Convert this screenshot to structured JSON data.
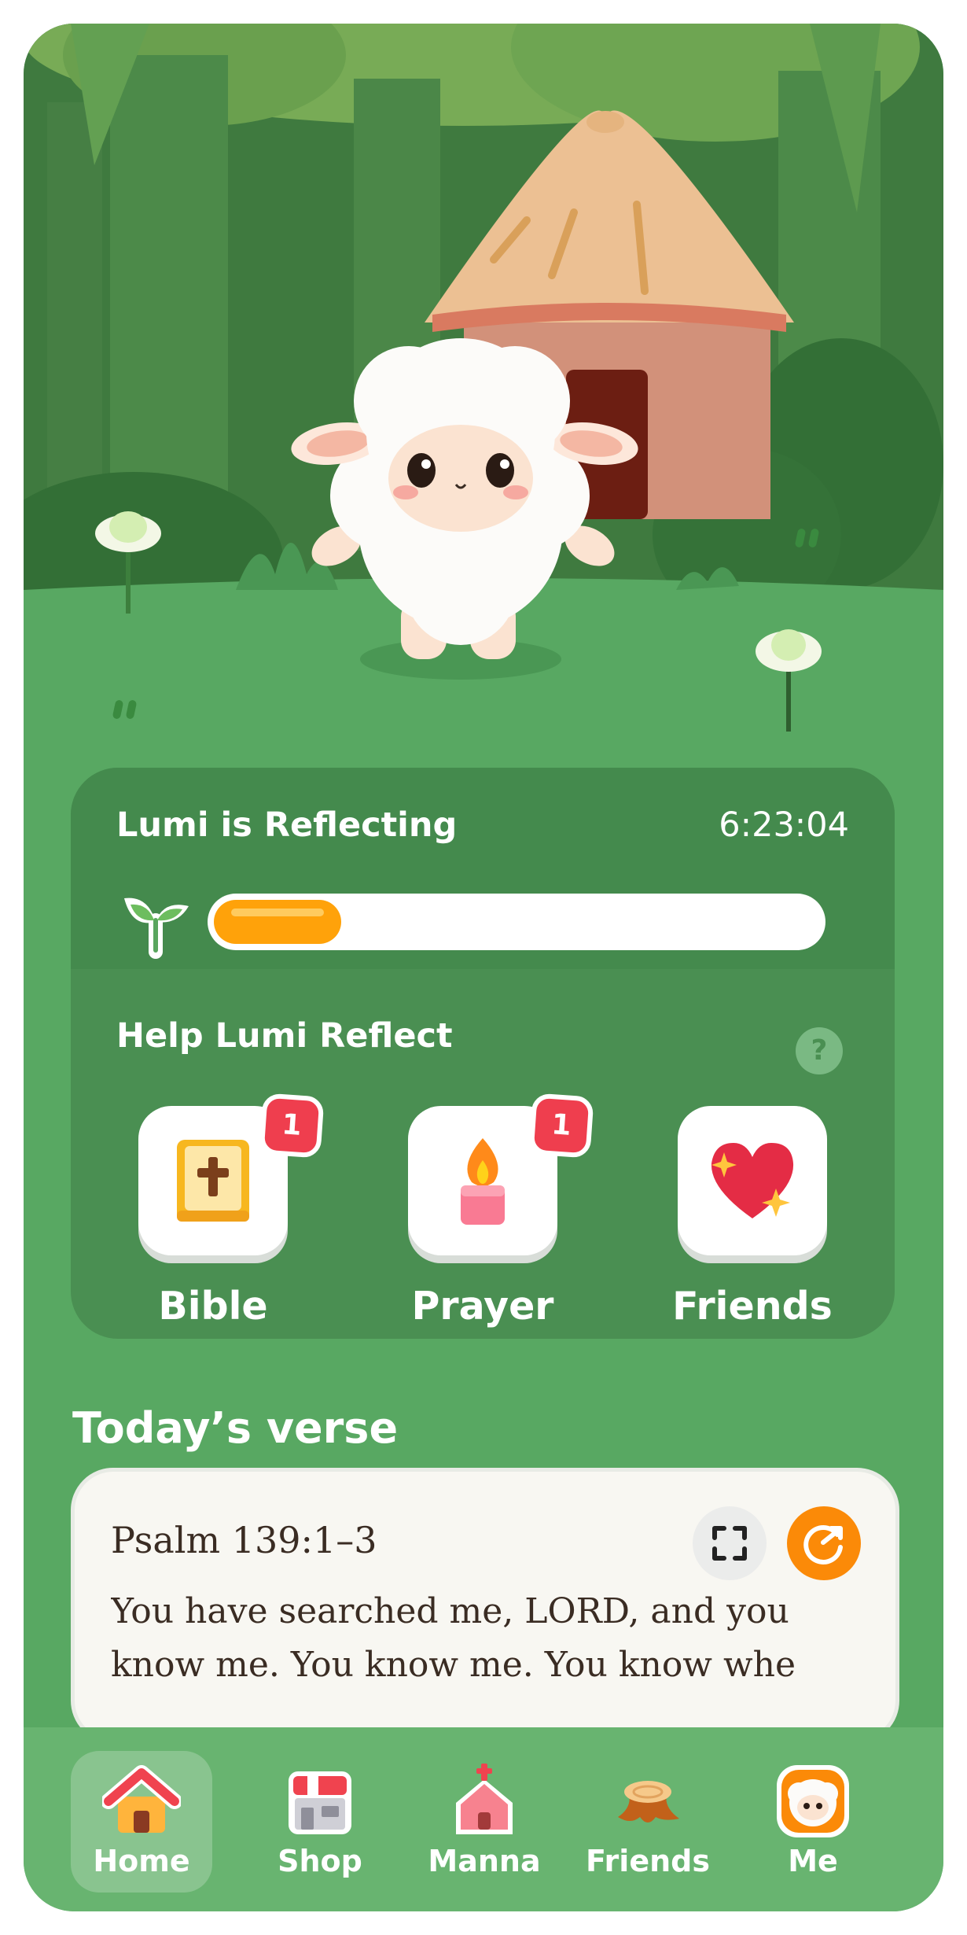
{
  "colors": {
    "background_green": "#58a862",
    "card_green": "#4a8f52",
    "progress_orange": "#ffa20a",
    "badge_red": "#ef3e4e",
    "share_orange": "#fb8a08"
  },
  "status": {
    "title": "Lumi is Reflecting",
    "timer": "6:23:04",
    "progress_fraction": 0.21,
    "sprout_icon": "sprout-icon"
  },
  "help": {
    "title": "Help Lumi Reflect",
    "help_icon_glyph": "?",
    "actions": [
      {
        "label": "Bible",
        "badge": "1",
        "icon": "bible-icon"
      },
      {
        "label": "Prayer",
        "badge": "1",
        "icon": "candle-icon"
      },
      {
        "label": "Friends",
        "badge": "",
        "icon": "sparkle-heart-icon"
      }
    ]
  },
  "verse": {
    "heading": "Today’s verse",
    "reference": "Psalm 139:1–3",
    "text_line1": "You have searched me, LORD, and you",
    "text_line2": "know me. You know me. You know whe"
  },
  "nav": {
    "items": [
      {
        "label": "Home",
        "icon": "home-icon",
        "active": true
      },
      {
        "label": "Shop",
        "icon": "shop-icon",
        "active": false
      },
      {
        "label": "Manna",
        "icon": "church-icon",
        "active": false
      },
      {
        "label": "Friends",
        "icon": "tree-stump-icon",
        "active": false
      },
      {
        "label": "Me",
        "icon": "sheep-avatar-icon",
        "active": false
      }
    ]
  }
}
